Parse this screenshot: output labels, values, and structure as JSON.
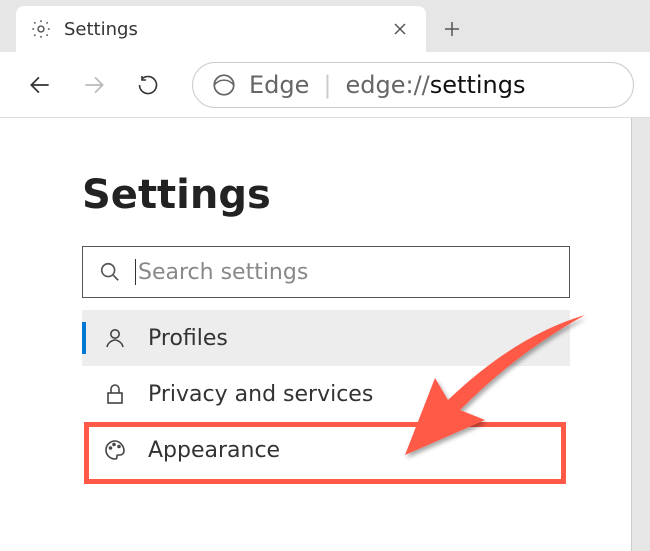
{
  "tab": {
    "title": "Settings"
  },
  "address": {
    "brand": "Edge",
    "url_scheme": "edge://",
    "url_path": "settings"
  },
  "page": {
    "title": "Settings"
  },
  "search": {
    "placeholder": "Search settings"
  },
  "nav": {
    "items": [
      {
        "label": "Profiles"
      },
      {
        "label": "Privacy and services"
      },
      {
        "label": "Appearance"
      }
    ]
  },
  "annotation": {
    "highlight_color": "#ff5a47"
  }
}
